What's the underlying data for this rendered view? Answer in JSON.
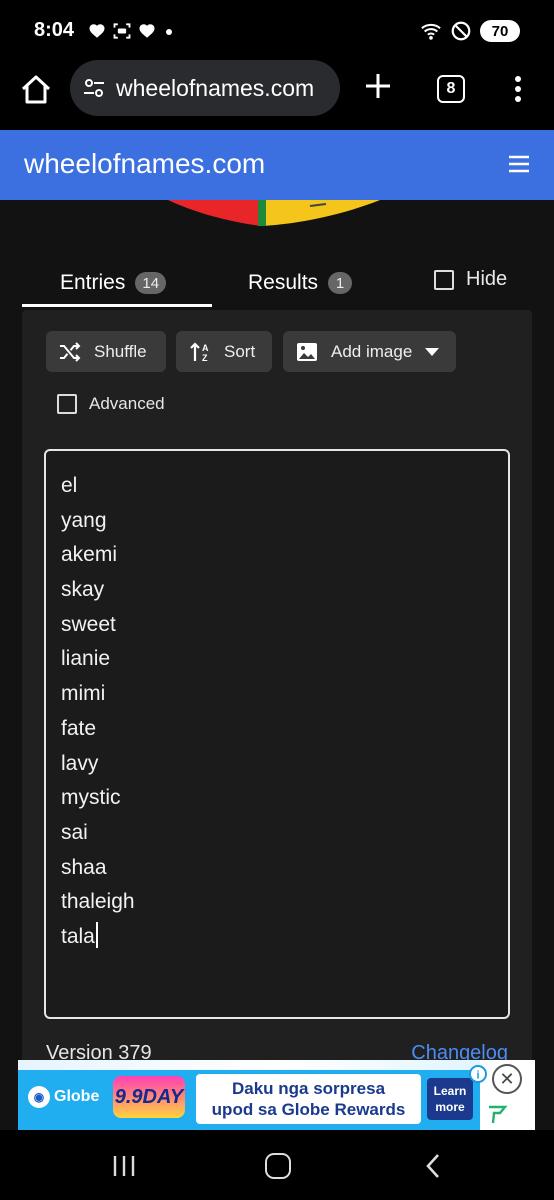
{
  "status_bar": {
    "time": "8:04",
    "battery": "70",
    "left_icons": [
      "heart-icon",
      "screenshot-icon",
      "heart-icon",
      "dot-icon"
    ],
    "right_icons": [
      "wifi-icon",
      "do-not-disturb-icon",
      "battery-icon"
    ]
  },
  "browser": {
    "url": "wheelofnames.com",
    "tab_count": "8"
  },
  "site": {
    "title": "wheelofnames.com"
  },
  "tabs": {
    "entries_label": "Entries",
    "entries_count": "14",
    "results_label": "Results",
    "results_count": "1",
    "hide_label": "Hide"
  },
  "toolbar": {
    "shuffle_label": "Shuffle",
    "sort_label": "Sort",
    "add_image_label": "Add image",
    "advanced_label": "Advanced"
  },
  "entries": [
    "el",
    "yang",
    "akemi",
    "skay",
    "sweet",
    "lianie",
    "mimi",
    "fate",
    "lavy",
    "mystic",
    "sai",
    "shaa",
    "thaleigh",
    "tala"
  ],
  "footer": {
    "version": "Version 379",
    "changelog": "Changelog"
  },
  "ad": {
    "brand": "Globe",
    "badge": "9.9DAY",
    "headline_line1": "Daku nga sorpresa",
    "headline_line2": "upod sa Globe Rewards",
    "cta_line1": "Learn",
    "cta_line2": "more"
  },
  "colors": {
    "header_blue": "#3c6fe0",
    "link_blue": "#4c8cf5",
    "ad_blue": "#21aef0"
  }
}
